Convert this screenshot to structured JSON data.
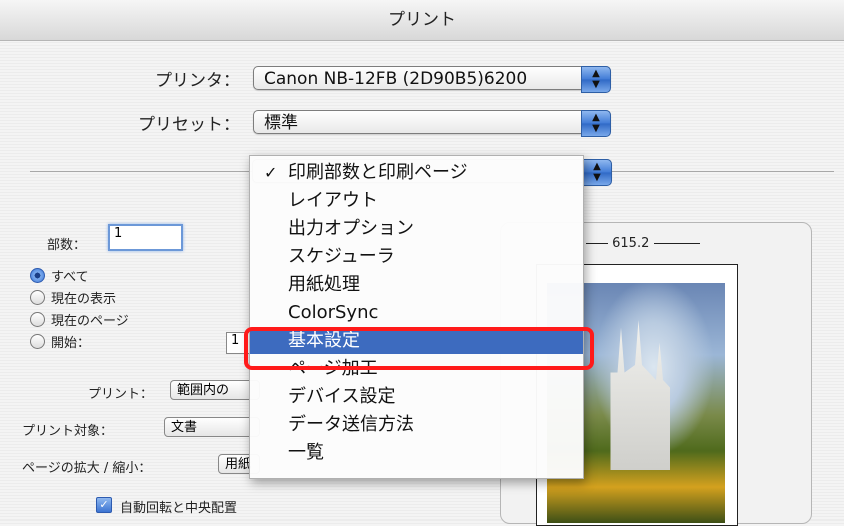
{
  "window": {
    "title": "プリント"
  },
  "printer": {
    "label": "プリンタ：",
    "value": "Canon NB-12FB (2D90B5)6200"
  },
  "preset": {
    "label": "プリセット：",
    "value": "標準"
  },
  "copies": {
    "label": "部数：",
    "value": "1"
  },
  "pages": {
    "options": [
      "すべて",
      "現在の表示",
      "現在のページ",
      "開始："
    ],
    "selected_index": 0,
    "from_value": "1"
  },
  "print_range": {
    "label": "プリント：",
    "value": "範囲内の"
  },
  "print_target": {
    "label": "プリント対象：",
    "value": "文書"
  },
  "scale": {
    "label": "ページの拡大 / 縮小：",
    "value": "用紙"
  },
  "auto_rotate": {
    "label": "自動回転と中央配置",
    "checked": true
  },
  "preview": {
    "width_dim": "615.2"
  },
  "menu": {
    "items": [
      {
        "label": "印刷部数と印刷ページ",
        "checked": true
      },
      {
        "label": "レイアウト"
      },
      {
        "label": "出力オプション"
      },
      {
        "label": "スケジューラ"
      },
      {
        "label": "用紙処理"
      },
      {
        "label": "ColorSync"
      },
      {
        "label": "基本設定",
        "selected": true
      },
      {
        "label": "ページ加工"
      },
      {
        "label": "デバイス設定"
      },
      {
        "label": "データ送信方法"
      },
      {
        "label": "一覧"
      }
    ],
    "check_glyph": "✓"
  },
  "colors": {
    "selection": "#3d6bbf",
    "highlight_box": "#ff1a1a"
  }
}
